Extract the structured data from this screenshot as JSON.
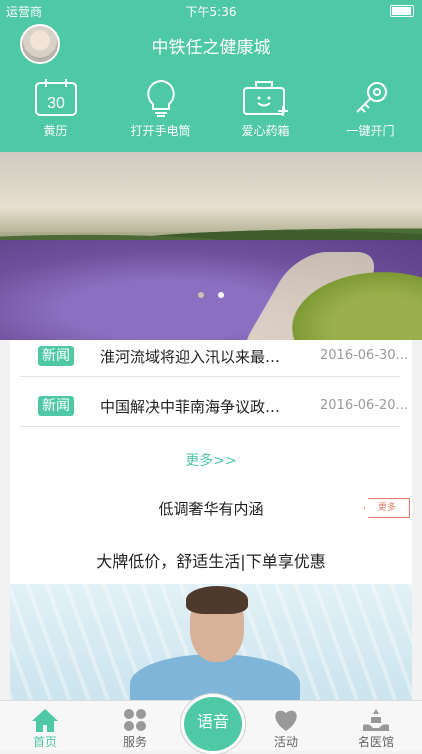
{
  "status": {
    "carrier": "运营商",
    "time": "下午5:36"
  },
  "header": {
    "title": "中铁任之健康城"
  },
  "quick": [
    {
      "label": "黄历",
      "icon": "calendar-icon"
    },
    {
      "label": "打开手电筒",
      "icon": "lightbulb-icon"
    },
    {
      "label": "爱心药箱",
      "icon": "medicine-box-icon"
    },
    {
      "label": "一键开门",
      "icon": "key-icon"
    }
  ],
  "banner": {
    "pages": 2,
    "active": 2
  },
  "news": {
    "items": [
      {
        "tag": "新闻",
        "title": "淮河流域将迎入汛以来最…",
        "date": "2016-06-30…"
      },
      {
        "tag": "新闻",
        "title": "中国解决中菲南海争议政…",
        "date": "2016-06-20…"
      }
    ],
    "more": "更多>>"
  },
  "promo": {
    "heading": "低调奢华有内涵",
    "badge": "更多",
    "subheading": "大牌低价，舒适生活|下单享优惠"
  },
  "tabs": [
    {
      "label": "首页",
      "icon": "home-icon",
      "active": true
    },
    {
      "label": "服务",
      "icon": "grid-icon"
    },
    {
      "label": "活动",
      "icon": "heart-icon"
    },
    {
      "label": "名医馆",
      "icon": "doctor-hands-icon"
    }
  ],
  "voice": {
    "label": "语音"
  },
  "colors": {
    "brand": "#4fc8a6",
    "accent": "#e57b6a"
  }
}
